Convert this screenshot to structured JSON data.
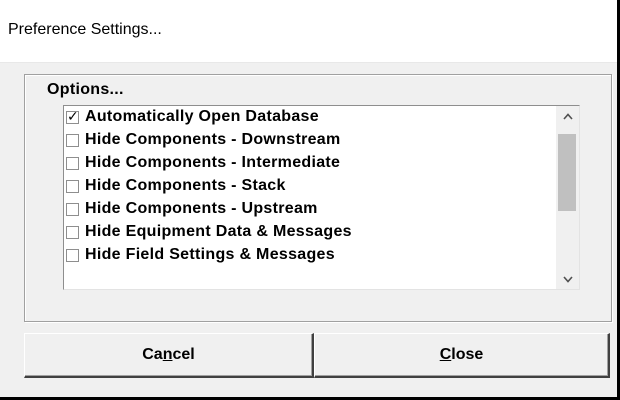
{
  "window": {
    "title": "Preference Settings..."
  },
  "options": {
    "label": "Options...",
    "items": [
      {
        "label": "Automatically Open Database",
        "checked": true
      },
      {
        "label": "Hide Components - Downstream",
        "checked": false
      },
      {
        "label": "Hide Components - Intermediate",
        "checked": false
      },
      {
        "label": "Hide Components - Stack",
        "checked": false
      },
      {
        "label": "Hide Components - Upstream",
        "checked": false
      },
      {
        "label": "Hide Equipment Data & Messages",
        "checked": false
      },
      {
        "label": "Hide Field Settings & Messages",
        "checked": false
      }
    ],
    "check_glyph": "✓",
    "scroll_up_icon": "^",
    "scroll_down_icon": "v"
  },
  "buttons": {
    "cancel": {
      "pre": "Ca",
      "mnemonic": "n",
      "post": "cel"
    },
    "close": {
      "pre": "",
      "mnemonic": "C",
      "post": "lose"
    }
  }
}
